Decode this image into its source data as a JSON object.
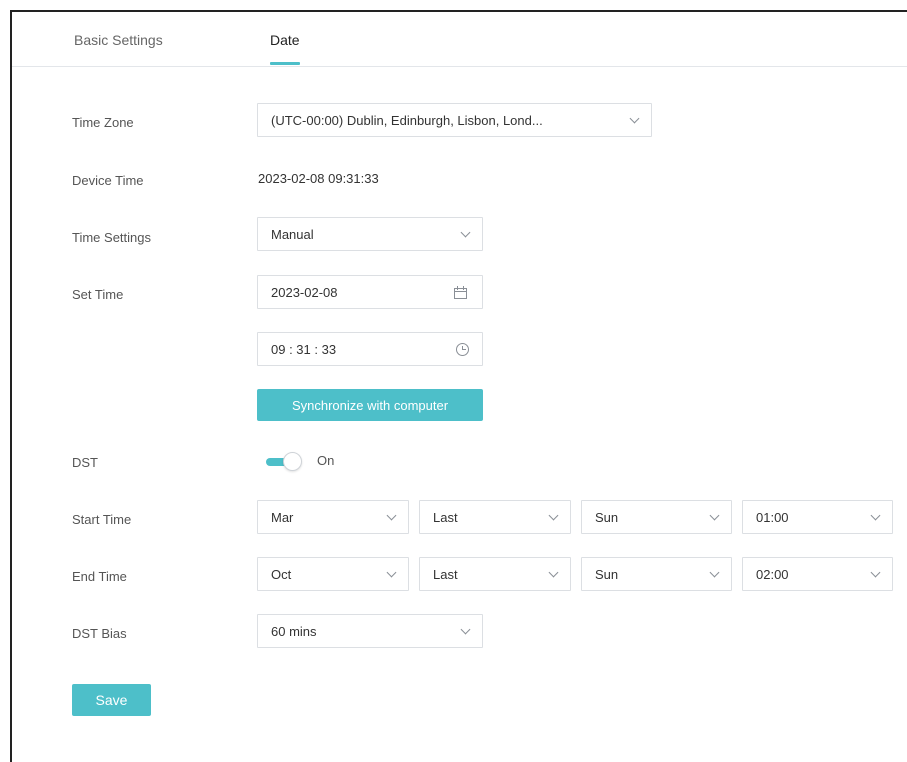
{
  "tabs": [
    {
      "label": "Basic Settings",
      "active": false
    },
    {
      "label": "Date",
      "active": true
    }
  ],
  "form": {
    "time_zone": {
      "label": "Time Zone",
      "value": "(UTC-00:00) Dublin, Edinburgh, Lisbon, Lond..."
    },
    "device_time": {
      "label": "Device Time",
      "value": "2023-02-08 09:31:33"
    },
    "time_settings": {
      "label": "Time Settings",
      "value": "Manual"
    },
    "set_time": {
      "label": "Set Time",
      "date": "2023-02-08",
      "time": "09 : 31 : 33"
    },
    "sync_button": "Synchronize with computer",
    "dst": {
      "label": "DST",
      "state": "On",
      "enabled": true
    },
    "start_time": {
      "label": "Start Time",
      "month": "Mar",
      "week": "Last",
      "day": "Sun",
      "time": "01:00"
    },
    "end_time": {
      "label": "End Time",
      "month": "Oct",
      "week": "Last",
      "day": "Sun",
      "time": "02:00"
    },
    "dst_bias": {
      "label": "DST Bias",
      "value": "60 mins"
    }
  },
  "save_button": "Save",
  "colors": {
    "accent": "#4dbfc9"
  }
}
